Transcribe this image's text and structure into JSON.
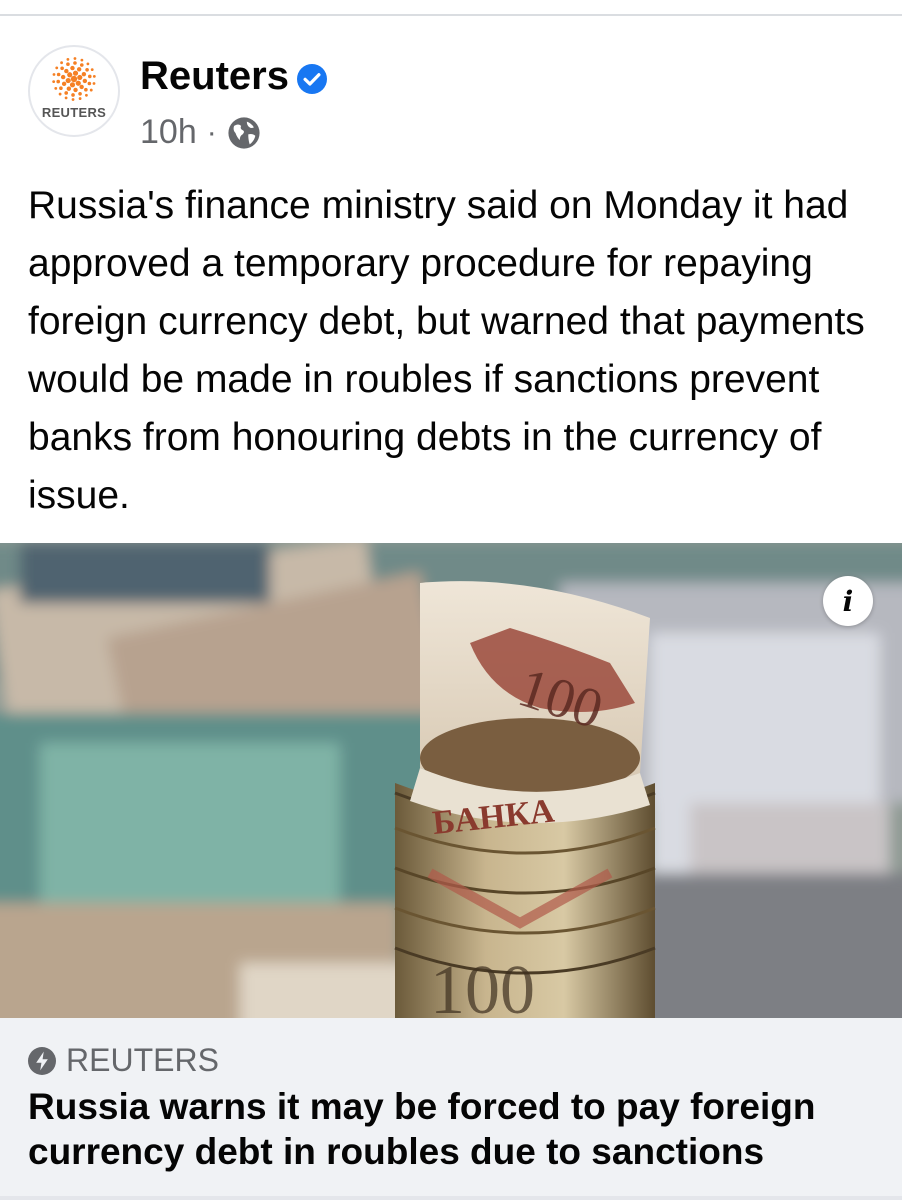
{
  "post": {
    "page_name": "Reuters",
    "avatar_label": "REUTERS",
    "timestamp": "10h",
    "separator": "·",
    "verified_icon": "verified-badge-icon",
    "privacy_icon": "globe-icon",
    "text": "Russia's finance ministry said on Monday it had approved a temporary procedure for repaying foreign currency debt, but warned that payments would be made in roubles if sanctions prevent banks from honouring debts in the currency of issue."
  },
  "photo": {
    "info_label": "i",
    "description": "Rolled rouble banknotes in the foreground over blurred banknotes",
    "banknote_text": "БАНКА"
  },
  "link_preview": {
    "source": "REUTERS",
    "title": "Russia warns it may be forced to pay foreign currency debt in roubles due to sanctions"
  },
  "colors": {
    "brand_orange": "#f58024",
    "verified_blue": "#1877f2",
    "secondary_text": "#65676b",
    "preview_bg": "#f0f2f5"
  }
}
